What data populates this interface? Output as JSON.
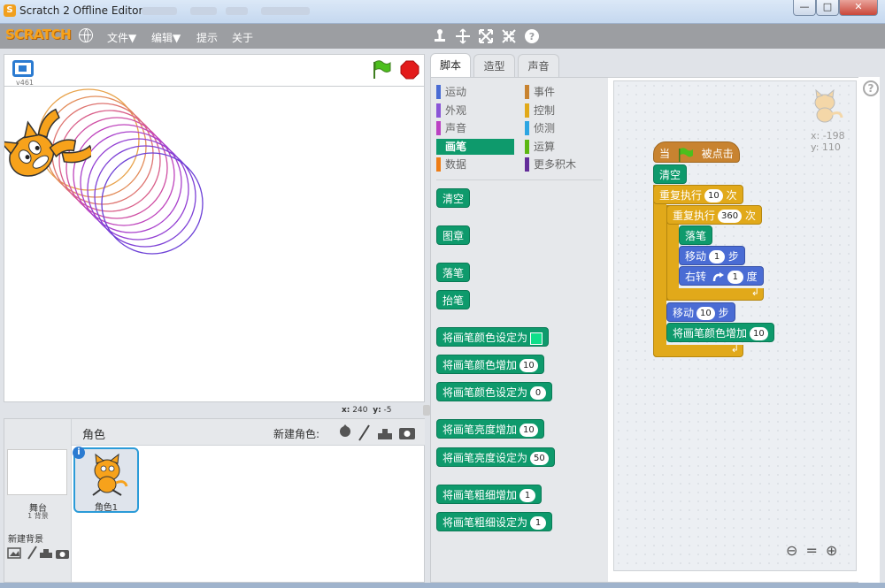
{
  "window": {
    "title": "Scratch 2 Offline Editor",
    "app_icon": "S",
    "buttons": {
      "minimize": "—",
      "maximize": "□",
      "close": "✕"
    }
  },
  "menubar": {
    "logo": "SCRATCH",
    "file": "文件▼",
    "edit": "编辑▼",
    "tips": "提示",
    "about": "关于",
    "icons": [
      "duplicate-icon",
      "delete-icon",
      "grow-icon",
      "shrink-icon",
      "help-icon"
    ]
  },
  "stage": {
    "version": "v461",
    "mouse": {
      "x_label": "x:",
      "x": "240",
      "y_label": "y:",
      "y": "-5"
    }
  },
  "sprites": {
    "header": "角色",
    "new_sprite_label": "新建角色:",
    "stage_name": "舞台",
    "stage_backdrops": "1 背景",
    "new_backdrop": "新建背景",
    "sprite_name": "角色1"
  },
  "tabs": [
    "脚本",
    "造型",
    "声音"
  ],
  "categories": [
    {
      "label": "运动",
      "color": "#4a6cd4"
    },
    {
      "label": "事件",
      "color": "#c88330"
    },
    {
      "label": "外观",
      "color": "#8a55d7"
    },
    {
      "label": "控制",
      "color": "#e1a91a"
    },
    {
      "label": "声音",
      "color": "#bb42c3"
    },
    {
      "label": "侦测",
      "color": "#2ca5e2"
    },
    {
      "label": "画笔",
      "color": "#0e9a6c",
      "selected": true
    },
    {
      "label": "运算",
      "color": "#5cb712"
    },
    {
      "label": "数据",
      "color": "#ee7d16"
    },
    {
      "label": "更多积木",
      "color": "#632d99"
    }
  ],
  "palette_blocks": [
    {
      "text": "清空"
    },
    {
      "text": "图章"
    },
    {
      "text": "落笔"
    },
    {
      "text": "抬笔"
    },
    {
      "text": "将画笔颜色设定为",
      "color_slot": true
    },
    {
      "text": "将画笔颜色增加",
      "value": "10"
    },
    {
      "text": "将画笔颜色设定为",
      "value": "0"
    },
    {
      "text": "将画笔亮度增加",
      "value": "10"
    },
    {
      "text": "将画笔亮度设定为",
      "value": "50"
    },
    {
      "text": "将画笔粗细增加",
      "value": "1"
    },
    {
      "text": "将画笔粗细设定为",
      "value": "1"
    }
  ],
  "script": {
    "hat_prefix": "当",
    "hat_suffix": "被点击",
    "clear": "清空",
    "repeat_outer": {
      "label": "重复执行",
      "value": "10",
      "suffix": "次"
    },
    "repeat_inner": {
      "label": "重复执行",
      "value": "360",
      "suffix": "次"
    },
    "pen_down": "落笔",
    "move_inner": {
      "label": "移动",
      "value": "1",
      "suffix": "步"
    },
    "turn_right": {
      "label": "右转",
      "value": "1",
      "suffix": "度"
    },
    "move_outer": {
      "label": "移动",
      "value": "10",
      "suffix": "步"
    },
    "change_color": {
      "label": "将画笔颜色增加",
      "value": "10"
    }
  },
  "sprite_info": {
    "x": "x: -198",
    "y": "y: 110"
  },
  "zoom": {
    "out": "⊖",
    "reset": "=",
    "in": "⊕"
  },
  "colors": {
    "pen": "#0e9a6c",
    "motion": "#4a6cd4",
    "control": "#e1a91a",
    "events": "#c88330",
    "accent": "#2b7bd1"
  }
}
